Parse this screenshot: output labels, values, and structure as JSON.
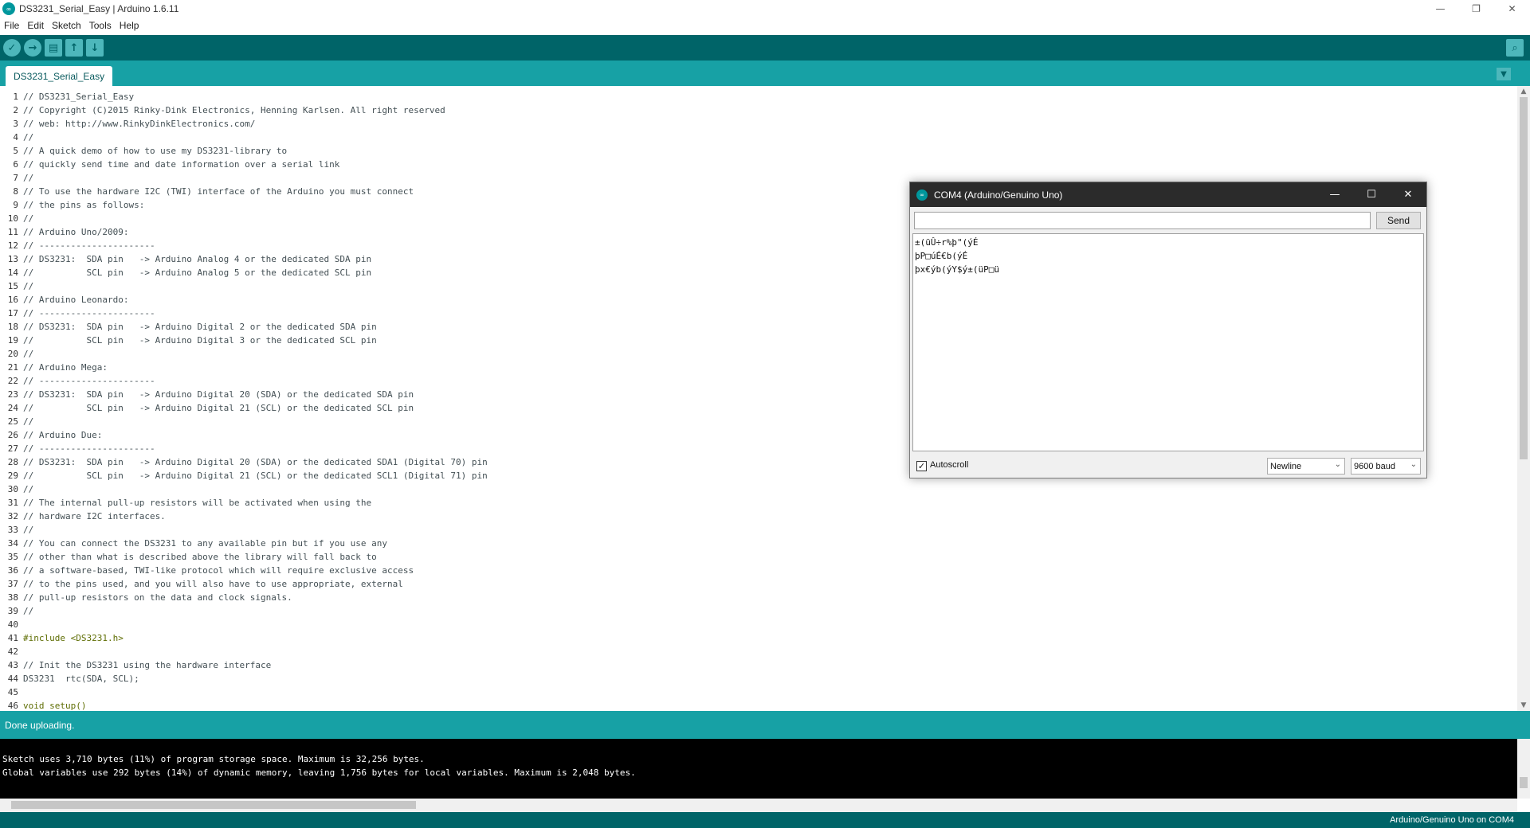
{
  "window": {
    "title": "DS3231_Serial_Easy | Arduino 1.6.11",
    "app_icon_glyph": "∞",
    "minimize": "—",
    "maximize": "❐",
    "close": "✕"
  },
  "menu": [
    "File",
    "Edit",
    "Sketch",
    "Tools",
    "Help"
  ],
  "toolbar": {
    "verify": "✓",
    "upload": "→",
    "new": "▤",
    "open": "↑",
    "save": "↓",
    "serial_monitor": "⌕"
  },
  "tabs": {
    "active": "DS3231_Serial_Easy",
    "menu_glyph": "▼"
  },
  "editor": {
    "lines": [
      "// DS3231_Serial_Easy",
      "// Copyright (C)2015 Rinky-Dink Electronics, Henning Karlsen. All right reserved",
      "// web: http://www.RinkyDinkElectronics.com/",
      "//",
      "// A quick demo of how to use my DS3231-library to",
      "// quickly send time and date information over a serial link",
      "//",
      "// To use the hardware I2C (TWI) interface of the Arduino you must connect",
      "// the pins as follows:",
      "//",
      "// Arduino Uno/2009:",
      "// ----------------------",
      "// DS3231:  SDA pin   -> Arduino Analog 4 or the dedicated SDA pin",
      "//          SCL pin   -> Arduino Analog 5 or the dedicated SCL pin",
      "//",
      "// Arduino Leonardo:",
      "// ----------------------",
      "// DS3231:  SDA pin   -> Arduino Digital 2 or the dedicated SDA pin",
      "//          SCL pin   -> Arduino Digital 3 or the dedicated SCL pin",
      "//",
      "// Arduino Mega:",
      "// ----------------------",
      "// DS3231:  SDA pin   -> Arduino Digital 20 (SDA) or the dedicated SDA pin",
      "//          SCL pin   -> Arduino Digital 21 (SCL) or the dedicated SCL pin",
      "//",
      "// Arduino Due:",
      "// ----------------------",
      "// DS3231:  SDA pin   -> Arduino Digital 20 (SDA) or the dedicated SDA1 (Digital 70) pin",
      "//          SCL pin   -> Arduino Digital 21 (SCL) or the dedicated SCL1 (Digital 71) pin",
      "//",
      "// The internal pull-up resistors will be activated when using the",
      "// hardware I2C interfaces.",
      "//",
      "// You can connect the DS3231 to any available pin but if you use any",
      "// other than what is described above the library will fall back to",
      "// a software-based, TWI-like protocol which will require exclusive access",
      "// to the pins used, and you will also have to use appropriate, external",
      "// pull-up resistors on the data and clock signals.",
      "//",
      "",
      "#include <DS3231.h>",
      "",
      "// Init the DS3231 using the hardware interface",
      "DS3231  rtc(SDA, SCL);",
      "",
      "void setup()"
    ],
    "scroll_up": "▲",
    "scroll_down": "▼"
  },
  "status": {
    "message": "Done uploading."
  },
  "console": {
    "lines": [
      "",
      "Sketch uses 3,710 bytes (11%) of program storage space. Maximum is 32,256 bytes.",
      "Global variables use 292 bytes (14%) of dynamic memory, leaving 1,756 bytes for local variables. Maximum is 2,048 bytes."
    ]
  },
  "board": {
    "label": "Arduino/Genuino Uno on COM4"
  },
  "serial_monitor": {
    "title": "COM4 (Arduino/Genuino Uno)",
    "input_value": "",
    "send_label": "Send",
    "output_lines": [
      "±(üÛ÷r%þ\"(ýÉ",
      "þP□úÉ€b(ýÉ",
      "þx€ýb(ýY$ý±(üP□ü"
    ],
    "autoscroll_label": "Autoscroll",
    "autoscroll_checked": "✓",
    "line_ending": "Newline",
    "baud": "9600 baud",
    "chevron": "⌄"
  },
  "colors": {
    "toolbar": "#006468",
    "tabbar": "#17a1a5",
    "status": "#17a1a5",
    "console": "#000000"
  }
}
